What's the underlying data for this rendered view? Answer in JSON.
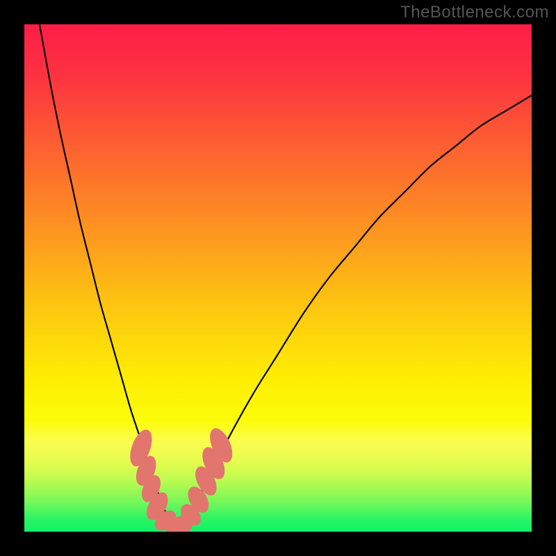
{
  "watermark": "TheBottleneck.com",
  "colors": {
    "frame": "#000000",
    "watermark": "#555555",
    "curve": "#000000",
    "marker": "#e2756e"
  },
  "gradient_stops": [
    {
      "offset": 0.0,
      "color": "#fd1e47"
    },
    {
      "offset": 0.1,
      "color": "#fd3240"
    },
    {
      "offset": 0.25,
      "color": "#fd6330"
    },
    {
      "offset": 0.4,
      "color": "#fd9321"
    },
    {
      "offset": 0.55,
      "color": "#fdc411"
    },
    {
      "offset": 0.7,
      "color": "#fdee04"
    },
    {
      "offset": 0.78,
      "color": "#fcfc08"
    },
    {
      "offset": 0.82,
      "color": "#fbfd4e"
    },
    {
      "offset": 0.86,
      "color": "#e7fc4e"
    },
    {
      "offset": 0.9,
      "color": "#bafb50"
    },
    {
      "offset": 0.94,
      "color": "#79f759"
    },
    {
      "offset": 0.975,
      "color": "#2bf464"
    },
    {
      "offset": 1.0,
      "color": "#12f269"
    }
  ],
  "chart_data": {
    "type": "line",
    "title": "",
    "xlabel": "",
    "ylabel": "",
    "xlim": [
      0,
      100
    ],
    "ylim": [
      0,
      100
    ],
    "grid": false,
    "legend": false,
    "annotations": [
      "TheBottleneck.com"
    ],
    "series": [
      {
        "name": "curve",
        "x": [
          3,
          5,
          7,
          9,
          11,
          13,
          15,
          17,
          19,
          21,
          23,
          25,
          27,
          30,
          33,
          36,
          40,
          45,
          50,
          55,
          60,
          65,
          70,
          75,
          80,
          85,
          90,
          95,
          100
        ],
        "y": [
          100,
          89,
          79,
          70,
          61,
          53,
          45,
          38,
          31,
          24,
          18,
          12,
          6,
          0,
          4,
          10,
          18,
          27,
          35,
          43,
          50,
          56,
          62,
          67,
          72,
          76,
          80,
          83,
          86
        ]
      }
    ],
    "markers": [
      {
        "x": 23.0,
        "y": 16.5,
        "rx": 1.8,
        "ry": 3.8,
        "rot": 20
      },
      {
        "x": 24.0,
        "y": 12.0,
        "rx": 1.7,
        "ry": 3.1,
        "rot": 22
      },
      {
        "x": 25.0,
        "y": 8.5,
        "rx": 1.6,
        "ry": 2.8,
        "rot": 24
      },
      {
        "x": 26.2,
        "y": 5.0,
        "rx": 1.7,
        "ry": 3.0,
        "rot": 30
      },
      {
        "x": 27.8,
        "y": 2.2,
        "rx": 1.6,
        "ry": 2.4,
        "rot": 50
      },
      {
        "x": 29.5,
        "y": 1.2,
        "rx": 1.8,
        "ry": 1.8,
        "rot": 0
      },
      {
        "x": 31.3,
        "y": 1.4,
        "rx": 1.8,
        "ry": 1.8,
        "rot": 0
      },
      {
        "x": 32.8,
        "y": 3.3,
        "rx": 1.6,
        "ry": 2.4,
        "rot": -40
      },
      {
        "x": 34.3,
        "y": 6.3,
        "rx": 1.7,
        "ry": 2.8,
        "rot": -30
      },
      {
        "x": 35.8,
        "y": 10.0,
        "rx": 1.7,
        "ry": 3.1,
        "rot": -28
      },
      {
        "x": 37.3,
        "y": 13.5,
        "rx": 1.8,
        "ry": 3.4,
        "rot": -26
      },
      {
        "x": 38.8,
        "y": 17.0,
        "rx": 1.8,
        "ry": 3.6,
        "rot": -24
      }
    ]
  }
}
